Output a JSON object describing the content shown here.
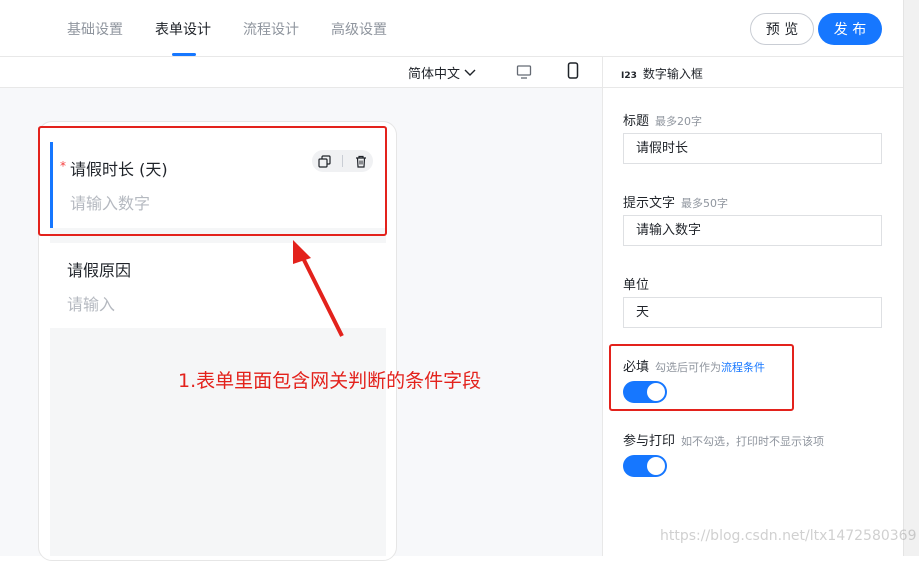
{
  "tabs": [
    {
      "label": "基础设置"
    },
    {
      "label": "表单设计"
    },
    {
      "label": "流程设计"
    },
    {
      "label": "高级设置"
    }
  ],
  "header": {
    "preview_label": "预 览",
    "publish_label": "发 布"
  },
  "toolbar": {
    "language": "简体中文"
  },
  "form": {
    "field1": {
      "required_mark": "*",
      "label": "请假时长 (天)",
      "placeholder": "请输入数字"
    },
    "field2": {
      "label": "请假原因",
      "placeholder": "请输入"
    }
  },
  "annotation": {
    "text": "1.表单里面包含网关判断的条件字段"
  },
  "panel": {
    "title": "数字输入框",
    "title_icon": "I23",
    "title_prop": {
      "label": "标题",
      "hint": "最多20字",
      "value": "请假时长"
    },
    "placeholder_prop": {
      "label": "提示文字",
      "hint": "最多50字",
      "value": "请输入数字"
    },
    "unit_prop": {
      "label": "单位",
      "value": "天"
    },
    "required_prop": {
      "label": "必填",
      "hint": "勾选后可作为",
      "link": "流程条件",
      "on": true
    },
    "print_prop": {
      "label": "参与打印",
      "hint": "如不勾选，打印时不显示该项",
      "on": true
    }
  },
  "watermark": "https://blog.csdn.net/ltx1472580369",
  "colors": {
    "accent": "#1677ff",
    "annotation": "#e3221c"
  }
}
